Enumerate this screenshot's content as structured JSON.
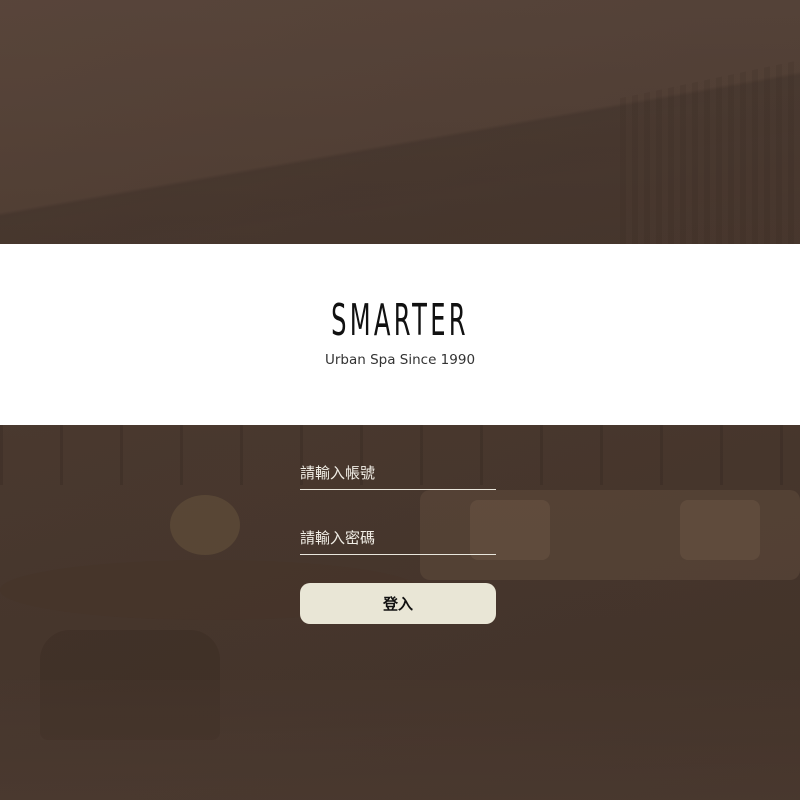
{
  "brand": {
    "wordmark": "SMARTER",
    "tagline": "Urban Spa Since 1990"
  },
  "login": {
    "account_placeholder": "請輸入帳號",
    "account_value": "",
    "password_placeholder": "請輸入密碼",
    "password_value": "",
    "submit_label": "登入"
  },
  "colors": {
    "background": "#4b3a30",
    "brand_band": "#ffffff",
    "button": "#e9e6d6",
    "underline": "#e9e6dc"
  }
}
